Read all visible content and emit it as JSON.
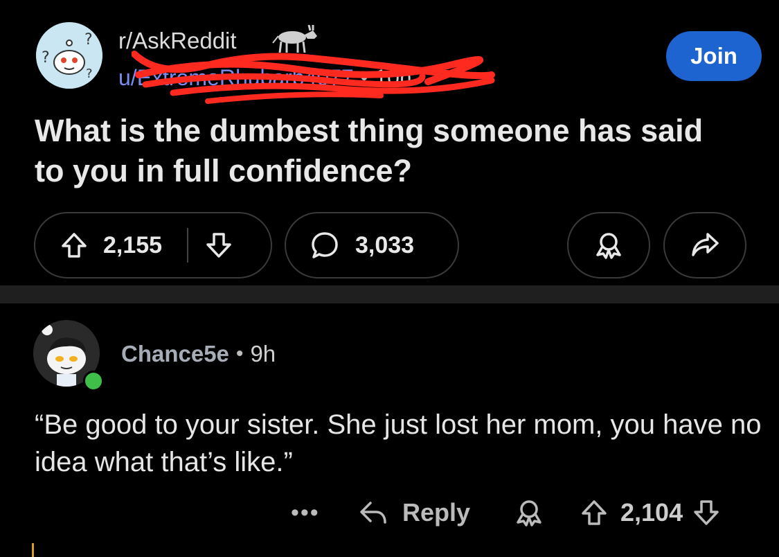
{
  "post": {
    "subreddit": "r/AskReddit",
    "author": "u/ExtremeRhubarb4077",
    "time": "10h",
    "separator": "•",
    "join_label": "Join",
    "title": "What is the dumbest thing someone has said to you in full confidence?",
    "upvotes": "2,155",
    "comments": "3,033",
    "icons": [
      "upvote-icon",
      "downvote-icon",
      "comment-icon",
      "award-icon",
      "share-icon"
    ]
  },
  "comment": {
    "user": "Chance5e",
    "time": "9h",
    "separator": "•",
    "body": "“Be good to your sister. She just lost her mom, you have no idea what that’s like.”",
    "more_label": "•••",
    "reply_label": "Reply",
    "score": "2,104"
  },
  "colors": {
    "background": "#000000",
    "join_button": "#1e64d0",
    "author_link": "#7a8cf0",
    "redaction": "#ff2a1f",
    "online_status": "#3fbf4a",
    "thread_line": "#d9a21b"
  }
}
